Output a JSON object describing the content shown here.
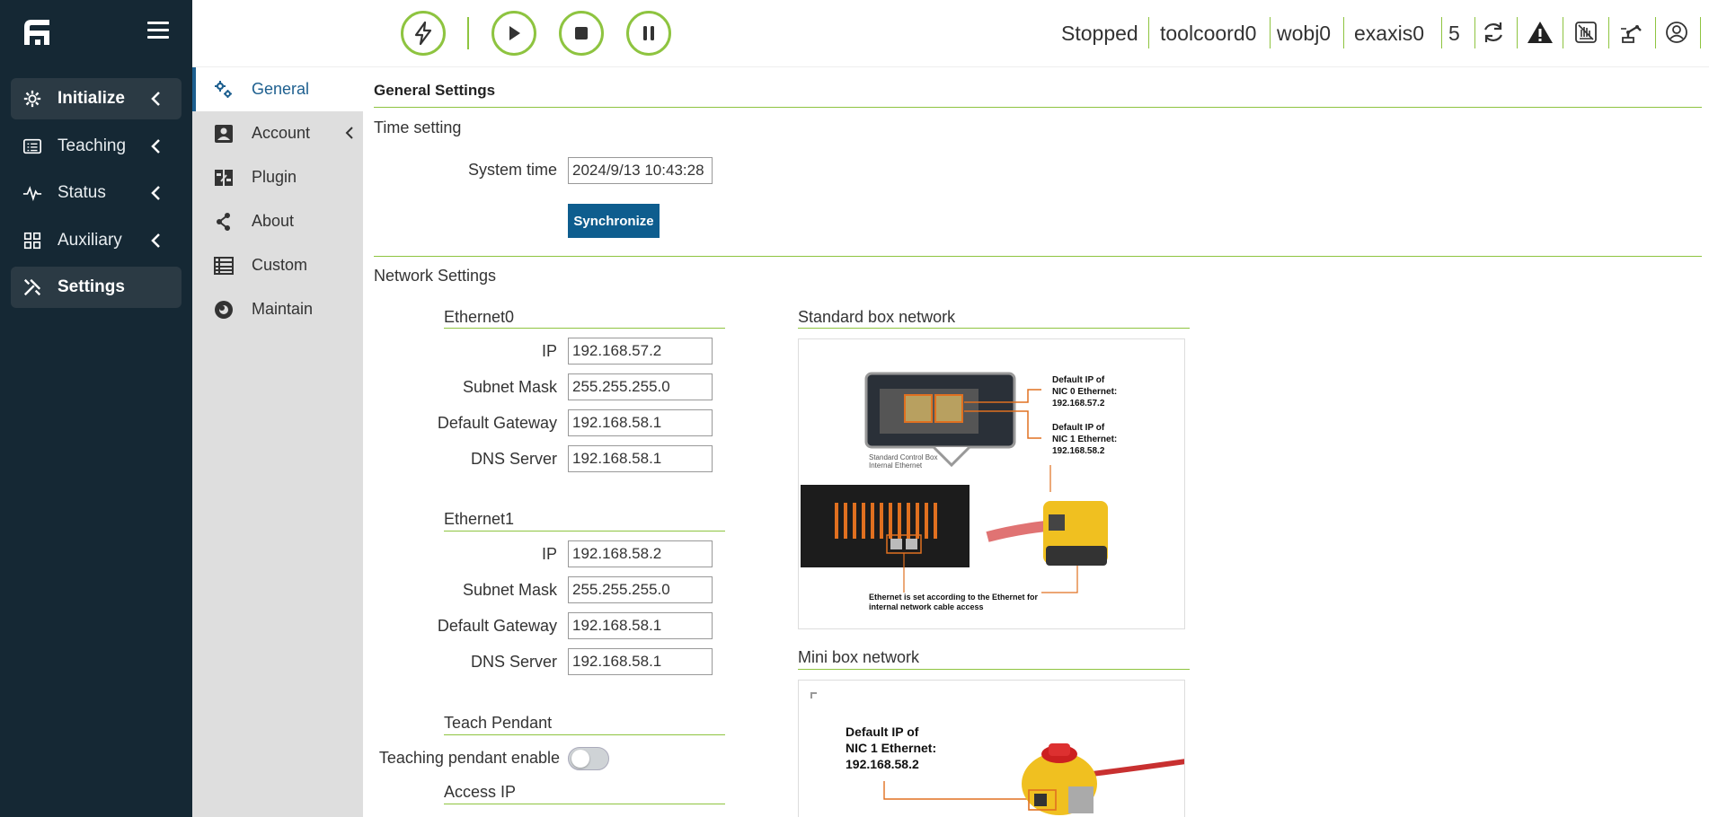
{
  "sidebar": {
    "items": [
      {
        "label": "Initialize",
        "icon": "gear-icon",
        "active": true
      },
      {
        "label": "Teaching",
        "icon": "list-icon",
        "active": false
      },
      {
        "label": "Status",
        "icon": "pulse-icon",
        "active": false
      },
      {
        "label": "Auxiliary",
        "icon": "grid-icon",
        "active": false
      },
      {
        "label": "Settings",
        "icon": "tools-icon",
        "active": true
      }
    ]
  },
  "subnav": {
    "items": [
      {
        "label": "General",
        "icon": "gears-icon"
      },
      {
        "label": "Account",
        "icon": "user-card-icon"
      },
      {
        "label": "Plugin",
        "icon": "plugin-icon"
      },
      {
        "label": "About",
        "icon": "share-icon"
      },
      {
        "label": "Custom",
        "icon": "table-icon"
      },
      {
        "label": "Maintain",
        "icon": "disc-icon"
      }
    ]
  },
  "topbar": {
    "state": "Stopped",
    "tool": "toolcoord0",
    "wobj": "wobj0",
    "exaxis": "exaxis0",
    "speed": "5"
  },
  "general": {
    "title": "General Settings",
    "time": {
      "title": "Time setting",
      "system_time_label": "System time",
      "system_time_value": "2024/9/13 10:43:28",
      "sync_label": "Synchronize"
    },
    "network": {
      "title": "Network Settings",
      "eth0": {
        "title": "Ethernet0",
        "ip_label": "IP",
        "ip": "192.168.57.2",
        "mask_label": "Subnet Mask",
        "mask": "255.255.255.0",
        "gw_label": "Default Gateway",
        "gw": "192.168.58.1",
        "dns_label": "DNS Server",
        "dns": "192.168.58.1"
      },
      "eth1": {
        "title": "Ethernet1",
        "ip_label": "IP",
        "ip": "192.168.58.2",
        "mask_label": "Subnet Mask",
        "mask": "255.255.255.0",
        "gw_label": "Default Gateway",
        "gw": "192.168.58.1",
        "dns_label": "DNS Server",
        "dns": "192.168.58.1"
      },
      "pendant": {
        "title": "Teach Pendant",
        "enable_label": "Teaching pendant enable",
        "access_ip_label": "Access IP"
      },
      "standard_box": {
        "title": "Standard box network",
        "nic0_line1": "Default IP of",
        "nic0_line2": "NIC 0 Ethernet:",
        "nic0_line3": "192.168.57.2",
        "nic1_line1": "Default IP of",
        "nic1_line2": "NIC 1 Ethernet:",
        "nic1_line3": "192.168.58.2",
        "internal_line1": "Standard Control Box",
        "internal_line2": "Internal Ethernet",
        "note_line1": "Ethernet is set according to the Ethernet for",
        "note_line2": "internal network cable access"
      },
      "mini_box": {
        "title": "Mini box network",
        "line1": "Default IP of",
        "line2": "NIC 1 Ethernet:",
        "line3": "192.168.58.2"
      }
    }
  },
  "colors": {
    "sidebar_bg": "#152834",
    "accent_green": "#8ec440",
    "primary_blue": "#0e5d8e",
    "subnav_bg": "#dedede"
  }
}
